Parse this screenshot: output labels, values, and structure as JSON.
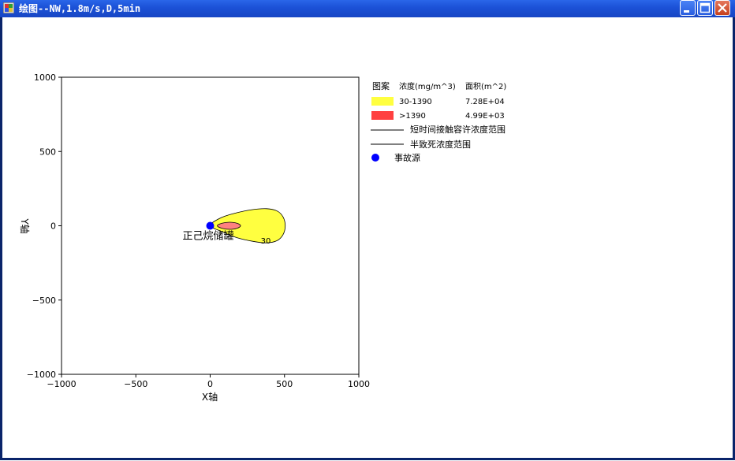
{
  "window": {
    "title": "绘图--NW,1.8m/s,D,5min"
  },
  "legend": {
    "header": {
      "pattern": "图案",
      "concentration": "浓度(mg/m^3)",
      "area": "面积(m^2)"
    },
    "rows": [
      {
        "color": "#ffff40",
        "range": "30-1390",
        "area": "7.28E+04"
      },
      {
        "color": "#ff4040",
        "range": ">1390",
        "area": "4.99E+03"
      }
    ],
    "lines": [
      {
        "label": "短时间接触容许浓度范围"
      },
      {
        "label": "半致死浓度范围"
      }
    ],
    "source": {
      "label": "事故源",
      "color": "#0000ff"
    }
  },
  "chart_data": {
    "type": "area",
    "xlabel": "X轴",
    "ylabel": "Y轴",
    "xlim": [
      -1000,
      1000
    ],
    "ylim": [
      -1000,
      1000
    ],
    "xticks": [
      "−1000",
      "−500",
      "0",
      "500",
      "1000"
    ],
    "yticks": [
      "1000",
      "500",
      "0",
      "−500",
      "−1000"
    ],
    "source_point": {
      "x": 0,
      "y": 0,
      "label": "正己烷储罐"
    },
    "contours": [
      {
        "name": "30-1390",
        "color": "#ffff40",
        "label": "30",
        "points": [
          [
            0,
            0
          ],
          [
            60,
            48
          ],
          [
            160,
            83
          ],
          [
            280,
            108
          ],
          [
            380,
            115
          ],
          [
            450,
            100
          ],
          [
            490,
            60
          ],
          [
            505,
            0
          ],
          [
            490,
            -60
          ],
          [
            450,
            -100
          ],
          [
            380,
            -115
          ],
          [
            300,
            -107
          ],
          [
            180,
            -80
          ],
          [
            80,
            -40
          ]
        ]
      },
      {
        "name": ">1390",
        "color": "#ff8080",
        "points": [
          [
            48,
            0
          ],
          [
            80,
            17
          ],
          [
            130,
            24
          ],
          [
            180,
            17
          ],
          [
            205,
            0
          ],
          [
            180,
            -17
          ],
          [
            130,
            -24
          ],
          [
            80,
            -17
          ]
        ]
      }
    ]
  }
}
